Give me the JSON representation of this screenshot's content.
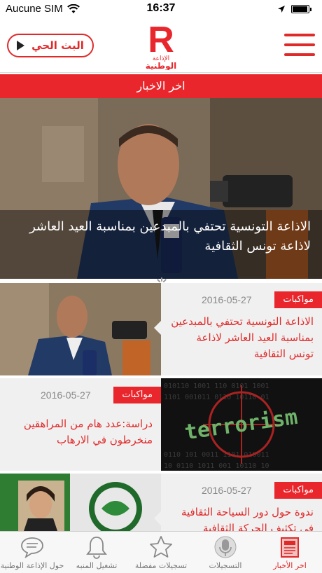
{
  "status_bar": {
    "carrier": "Aucune SIM",
    "time": "16:37",
    "battery_level": 0.95
  },
  "header": {
    "live_label": "البث الحي",
    "logo_text_line1": "الإذاعة",
    "logo_text_line2": "الوطنية",
    "logo_letter": "R"
  },
  "section_title": "اخر الاخبار",
  "hero": {
    "title": "الاذاعة التونسية تحتفي بالمبدعين بمناسبة العيد العاشر لاذاعة تونس الثقافية"
  },
  "news": [
    {
      "category": "مواكبات",
      "date": "2016-05-27",
      "title": "الاذاعة التونسية تحتفي بالمبدعين بمناسبة العيد العاشر لاذاعة تونس الثقافية",
      "image_side": "left"
    },
    {
      "category": "مواكبات",
      "date": "2016-05-27",
      "title": "دراسة:عدد هام من المراهقين منخرطون في الارهاب",
      "image_side": "right",
      "image_text": "terrorism"
    },
    {
      "category": "مواكبات",
      "date": "2016-05-27",
      "title": "ندوة حول دور السياحة الثقافية في تكثيف الحركة الثقافية",
      "image_side": "left"
    }
  ],
  "tabs": [
    {
      "label": "حول الإذاعة الوطنية",
      "icon": "chat-bubble-icon",
      "active": false
    },
    {
      "label": "تشغيل المنبه",
      "icon": "bell-icon",
      "active": false
    },
    {
      "label": "تسجيلات مفضلة",
      "icon": "star-icon",
      "active": false
    },
    {
      "label": "التسجيلات",
      "icon": "microphone-icon",
      "active": false
    },
    {
      "label": "اخر الأخبار",
      "icon": "newspaper-icon",
      "active": true
    }
  ],
  "colors": {
    "accent": "#e8262c",
    "tab_inactive": "#777777"
  }
}
